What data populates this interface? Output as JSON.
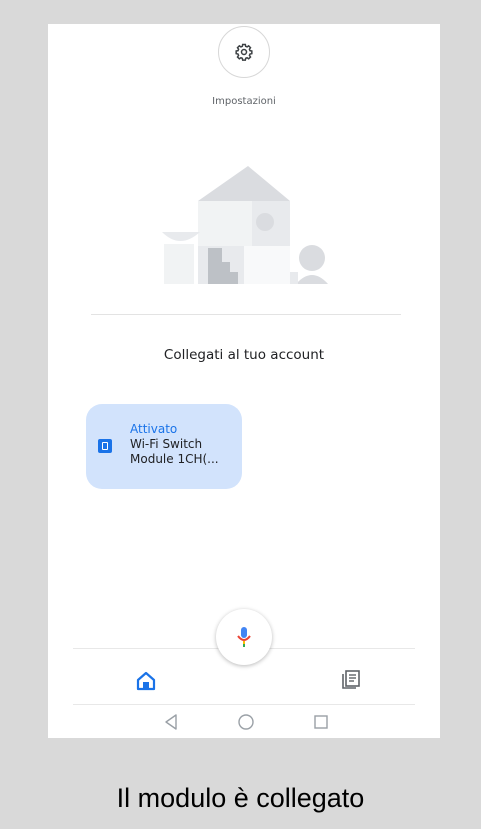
{
  "settings": {
    "label": "Impostazioni",
    "icon": "gear-icon"
  },
  "account": {
    "title": "Collegati al tuo account"
  },
  "device": {
    "status": "Attivato",
    "name": "Wi-Fi Switch Module 1CH(...",
    "icon": "switch-icon",
    "status_color": "#1a73e8",
    "card_color": "#d2e3fc"
  },
  "bottom_nav": {
    "home_icon": "home-icon",
    "feed_icon": "feed-icon",
    "mic_icon": "mic-icon"
  },
  "system_nav": {
    "back_icon": "back-icon",
    "home_icon": "home-circle-icon",
    "recents_icon": "recents-icon"
  },
  "caption": "Il modulo è collegato"
}
